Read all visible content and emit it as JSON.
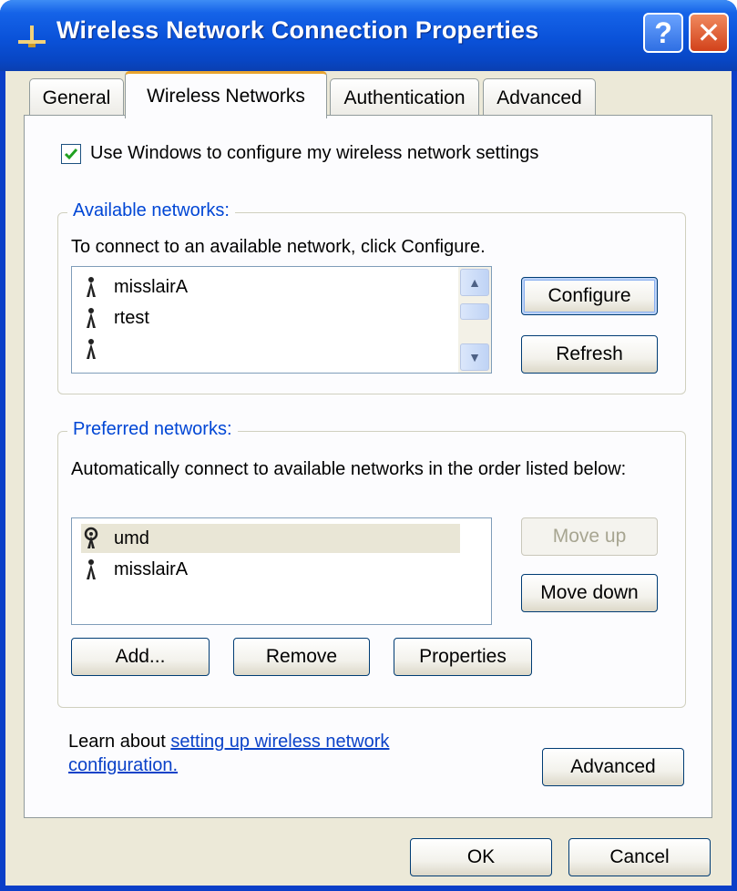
{
  "window": {
    "title": "Wireless Network Connection Properties",
    "help_glyph": "?",
    "close_glyph": "✕"
  },
  "tabs": [
    {
      "label": "General",
      "active": false
    },
    {
      "label": "Wireless Networks",
      "active": true
    },
    {
      "label": "Authentication",
      "active": false
    },
    {
      "label": "Advanced",
      "active": false
    }
  ],
  "use_windows": {
    "label": "Use Windows to configure my wireless network settings",
    "checked": true
  },
  "available": {
    "group_label": "Available networks:",
    "instructions": "To connect to an available network, click Configure.",
    "items": [
      "misslairA",
      "rtest",
      ""
    ],
    "configure_label": "Configure",
    "refresh_label": "Refresh"
  },
  "preferred": {
    "group_label": "Preferred networks:",
    "instructions": "Automatically connect to available networks in the order listed below:",
    "items": [
      {
        "name": "umd",
        "icon": "radio-tower-icon",
        "selected": true
      },
      {
        "name": "misslairA",
        "icon": "antenna-icon",
        "selected": false
      }
    ],
    "move_up_label": "Move up",
    "move_down_label": "Move down",
    "add_label": "Add...",
    "remove_label": "Remove",
    "properties_label": "Properties"
  },
  "learn": {
    "prefix": "Learn about ",
    "link_line1": "setting up wireless network",
    "link_line2": "configuration.",
    "advanced_label": "Advanced"
  },
  "footer": {
    "ok_label": "OK",
    "cancel_label": "Cancel"
  },
  "colors": {
    "titlebar": "#0a52d9",
    "group_label": "#0046d5",
    "link": "#0b42c8",
    "dialog_bg": "#ece9d8"
  }
}
